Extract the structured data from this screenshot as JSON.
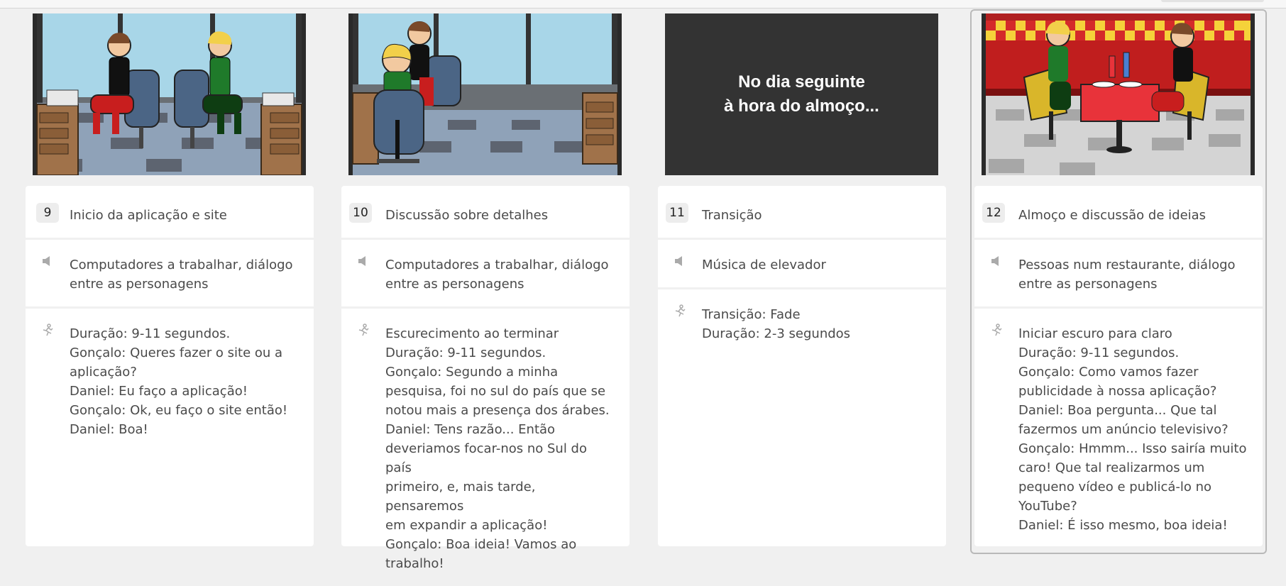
{
  "colors": {
    "page_background": "#f0f0f0",
    "card_background": "#ffffff",
    "badge_background": "#ededed",
    "transition_background": "#333333",
    "selected_outline": "#b9b9b9"
  },
  "icons": {
    "sound": "speaker-icon",
    "action": "running-figure-icon"
  },
  "panels": [
    {
      "number": "9",
      "title": "Inicio da aplicação e site",
      "scene": "office-two-chairs",
      "sound": "Computadores a trabalhar, diálogo\nentre as personagens",
      "action": "Duração: 9-11 segundos.\nGonçalo: Queres fazer o site ou a\naplicação?\nDaniel: Eu faço a aplicação!\nGonçalo: Ok, eu faço o site então!\nDaniel: Boa!",
      "selected": false
    },
    {
      "number": "10",
      "title": "Discussão sobre detalhes",
      "scene": "office-facing",
      "sound": "Computadores a trabalhar, diálogo\nentre as personagens",
      "action": "Escurecimento ao terminar\nDuração: 9-11 segundos.\nGonçalo: Segundo a minha\npesquisa, foi no sul do país que se\nnotou mais a presença dos árabes.\nDaniel: Tens razão... Então\ndeveriamos focar-nos no Sul do país\nprimeiro, e, mais tarde, pensaremos\nem expandir a aplicação!\nGonçalo: Boa ideia! Vamos ao\ntrabalho!",
      "selected": false
    },
    {
      "number": "11",
      "title": "Transição",
      "scene": "transition",
      "scene_text": "No dia seguinte\nà hora do almoço...",
      "sound": "Música de elevador",
      "action": "Transição: Fade\nDuração: 2-3 segundos",
      "selected": false
    },
    {
      "number": "12",
      "title": "Almoço e discussão de ideias",
      "scene": "restaurant",
      "sound": "Pessoas num restaurante, diálogo\nentre as personagens",
      "action": "Iniciar escuro para claro\nDuração: 9-11 segundos.\nGonçalo: Como vamos fazer\npublicidade à nossa aplicação?\nDaniel: Boa pergunta... Que tal\nfazermos um anúncio televisivo?\nGonçalo: Hmmm... Isso sairía muito\ncaro! Que tal realizarmos um\npequeno vídeo e publicá-lo no\nYouTube?\nDaniel: É isso mesmo, boa ideia!",
      "selected": true
    }
  ]
}
